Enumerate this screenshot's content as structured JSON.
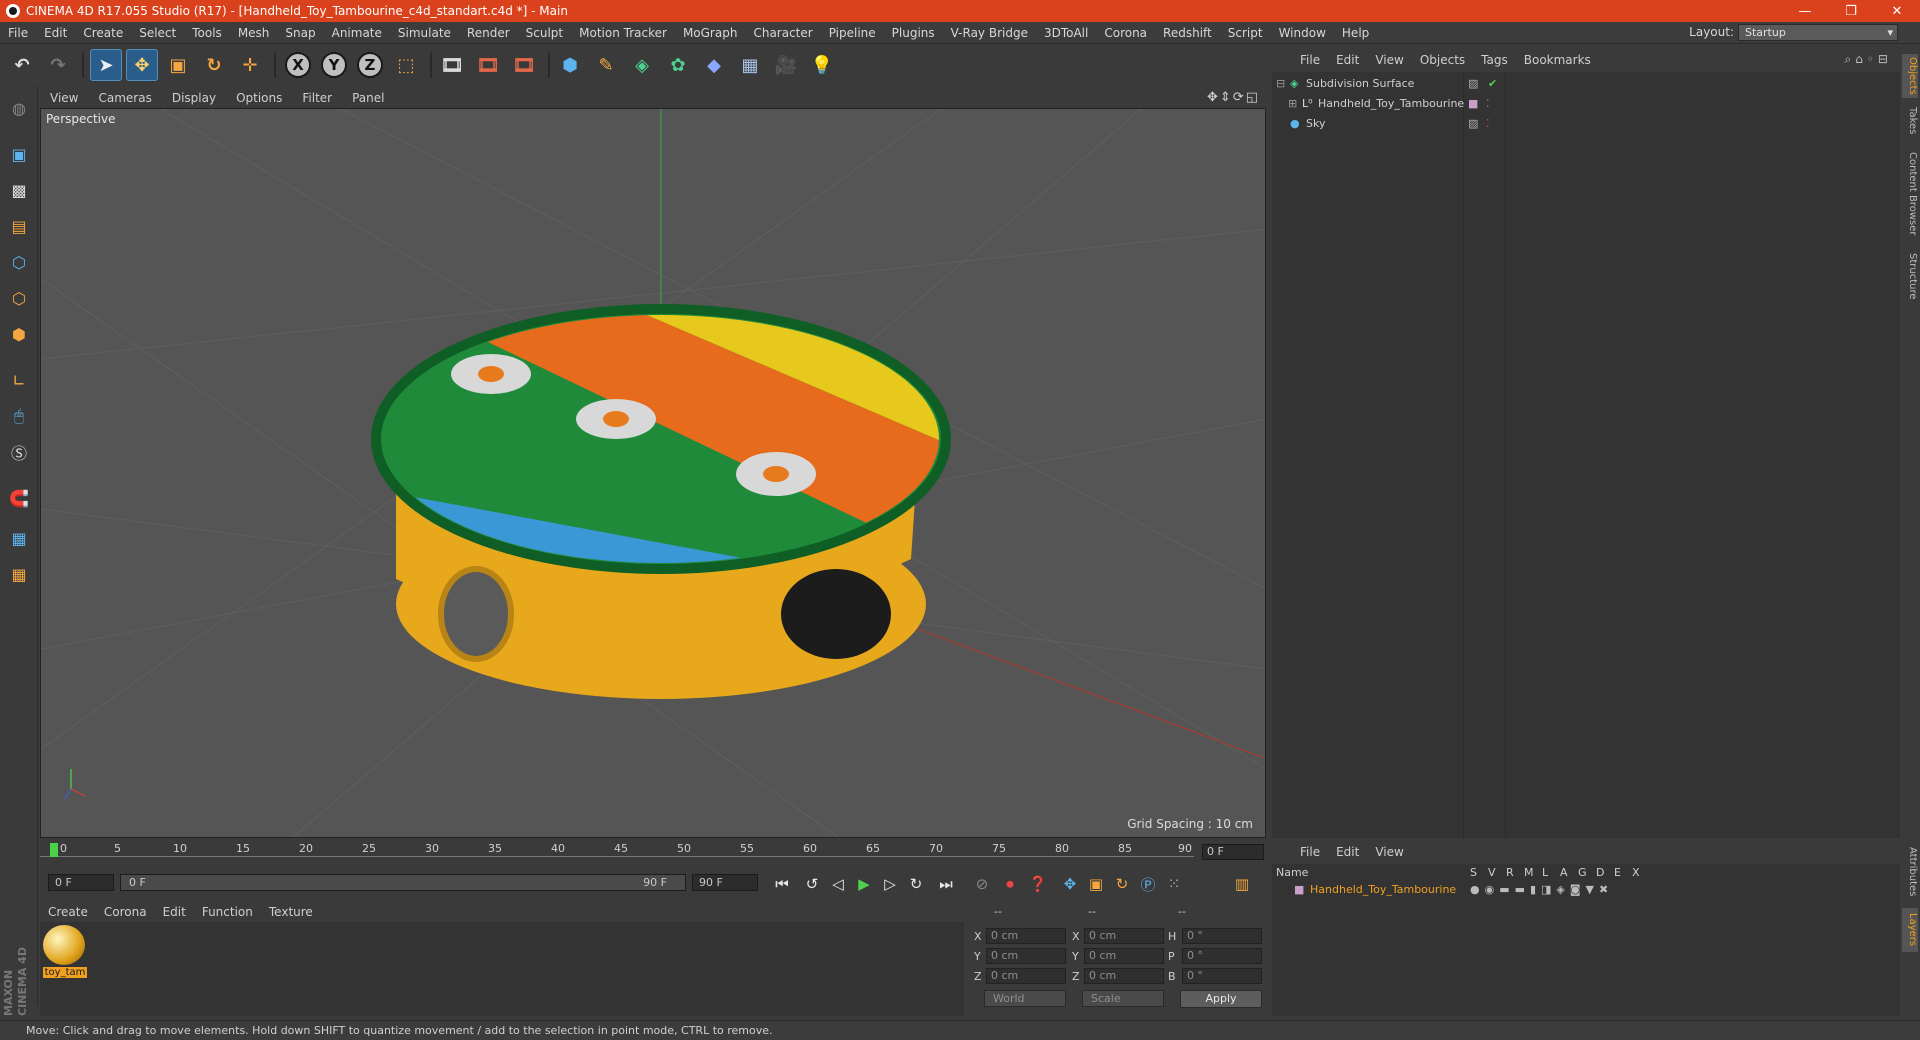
{
  "window": {
    "title": "CINEMA 4D R17.055 Studio (R17) - [Handheld_Toy_Tambourine_c4d_standart.c4d *] - Main",
    "controls": [
      "minimize-icon",
      "restore-icon",
      "close-icon"
    ]
  },
  "menu": {
    "items": [
      "File",
      "Edit",
      "Create",
      "Select",
      "Tools",
      "Mesh",
      "Snap",
      "Animate",
      "Simulate",
      "Render",
      "Sculpt",
      "Motion Tracker",
      "MoGraph",
      "Character",
      "Pipeline",
      "Plugins",
      "V-Ray Bridge",
      "3DToAll",
      "Corona",
      "Redshift",
      "Script",
      "Window",
      "Help"
    ],
    "layout_label": "Layout:",
    "layout_value": "Startup"
  },
  "toolbar": {
    "axis_x": "X",
    "axis_y": "Y",
    "axis_z": "Z"
  },
  "viewport": {
    "menu": [
      "View",
      "Cameras",
      "Display",
      "Options",
      "Filter",
      "Panel"
    ],
    "label": "Perspective",
    "grid_spacing": "Grid Spacing : 10 cm"
  },
  "timeline": {
    "ticks": [
      "0",
      "5",
      "10",
      "15",
      "20",
      "25",
      "30",
      "35",
      "40",
      "45",
      "50",
      "55",
      "60",
      "65",
      "70",
      "75",
      "80",
      "85",
      "90"
    ],
    "current_frame_field": "0 F",
    "start_field": "0 F",
    "range_start": "0 F",
    "range_end": "90 F",
    "end_field": "90 F"
  },
  "material_manager": {
    "menu": [
      "Create",
      "Corona",
      "Edit",
      "Function",
      "Texture"
    ],
    "materials": [
      {
        "name": "toy_tam"
      }
    ],
    "logo_lines": [
      "MAXON",
      "CINEMA 4D"
    ]
  },
  "coordinates": {
    "header": [
      "--",
      "--",
      "--"
    ],
    "rows": [
      {
        "pos_label": "X",
        "pos_value": "0 cm",
        "size_label": "X",
        "size_value": "0 cm",
        "rot_label": "H",
        "rot_value": "0 °"
      },
      {
        "pos_label": "Y",
        "pos_value": "0 cm",
        "size_label": "Y",
        "size_value": "0 cm",
        "rot_label": "P",
        "rot_value": "0 °"
      },
      {
        "pos_label": "Z",
        "pos_value": "0 cm",
        "size_label": "Z",
        "size_value": "0 cm",
        "rot_label": "B",
        "rot_value": "0 °"
      }
    ],
    "mode_world": "World",
    "mode_scale": "Scale",
    "apply_label": "Apply"
  },
  "object_manager": {
    "menu": [
      "File",
      "Edit",
      "View",
      "Objects",
      "Tags",
      "Bookmarks"
    ],
    "objects": [
      {
        "name": "Subdivision Surface",
        "icon": "subdivision-icon"
      },
      {
        "name": "Handheld_Toy_Tambourine",
        "icon": "null-object-icon"
      },
      {
        "name": "Sky",
        "icon": "sky-icon"
      }
    ]
  },
  "layer_manager": {
    "menu": [
      "File",
      "Edit",
      "View"
    ],
    "columns": [
      "Name",
      "S",
      "V",
      "R",
      "M",
      "L",
      "A",
      "G",
      "D",
      "E",
      "X"
    ],
    "layers": [
      {
        "name": "Handheld_Toy_Tambourine",
        "color": "#c8a0c8"
      }
    ]
  },
  "side_tabs": [
    "Objects",
    "Takes",
    "Content Browser",
    "Structure",
    "Attributes",
    "Layers"
  ],
  "status": {
    "text": "Move: Click and drag to move elements. Hold down SHIFT to quantize movement / add to the selection in point mode, CTRL to remove."
  },
  "colors": {
    "titlebar": "#d9421c",
    "accent_selected": "#2a5d8a",
    "layer_name": "#f0a020"
  }
}
